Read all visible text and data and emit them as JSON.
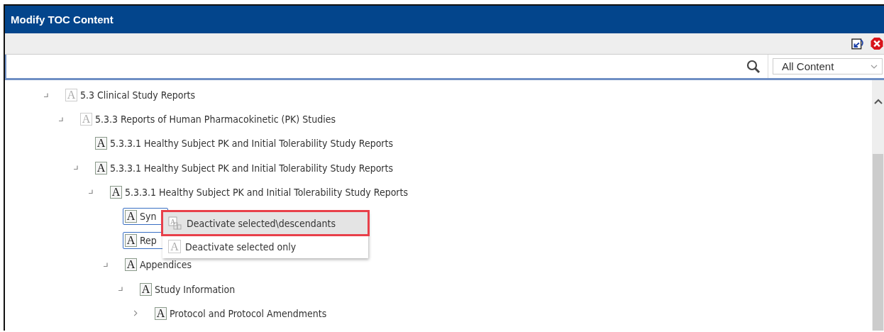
{
  "window": {
    "title": "Modify TOC Content"
  },
  "search": {
    "filter": "All Content"
  },
  "tree": [
    {
      "label": "5.3 Clinical Study Reports",
      "icon": "A",
      "active": false,
      "expanded": true,
      "selected": false,
      "children": [
        {
          "label": "5.3.3 Reports of Human Pharmacokinetic (PK) Studies",
          "icon": "A",
          "active": false,
          "expanded": true,
          "selected": false,
          "children": [
            {
              "label": "5.3.3.1 Healthy Subject PK and Initial Tolerability Study Reports",
              "icon": "A",
              "active": true,
              "selected": false
            },
            {
              "label": "5.3.3.1 Healthy Subject PK and Initial Tolerability Study Reports",
              "icon": "A",
              "active": true,
              "expanded": true,
              "selected": false,
              "children": [
                {
                  "label": "5.3.3.1 Healthy Subject PK and Initial Tolerability Study Reports",
                  "icon": "A",
                  "active": true,
                  "expanded": true,
                  "selected": false,
                  "children": [
                    {
                      "label": "Syn",
                      "icon": "A",
                      "active": true,
                      "selected": true
                    },
                    {
                      "label": "Rep",
                      "icon": "A",
                      "active": true,
                      "selected": true
                    },
                    {
                      "label": "Appendices",
                      "icon": "A",
                      "active": true,
                      "expanded": true,
                      "selected": false,
                      "children": [
                        {
                          "label": "Study Information",
                          "icon": "A",
                          "active": true,
                          "expanded": true,
                          "selected": false,
                          "children": [
                            {
                              "label": "Protocol and Protocol Amendments",
                              "icon": "A",
                              "active": true,
                              "expanded": false,
                              "selected": false
                            }
                          ]
                        }
                      ]
                    }
                  ]
                }
              ]
            }
          ]
        }
      ]
    }
  ],
  "context_menu": [
    {
      "label": "Deactivate selected\\descendants",
      "icon": "A",
      "kind": "descendants",
      "selected": true
    },
    {
      "label": "Deactivate selected only",
      "icon": "A",
      "kind": "single",
      "selected": false
    }
  ]
}
